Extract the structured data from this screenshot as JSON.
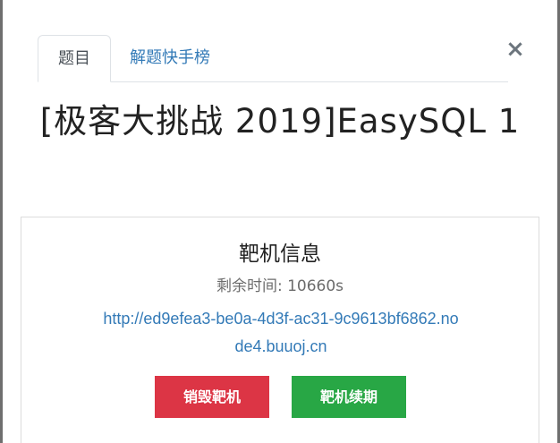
{
  "tabs": {
    "challenge": "题目",
    "leaderboard": "解题快手榜"
  },
  "close_symbol": "×",
  "challenge": {
    "title": "[极客大挑战 2019]EasySQL 1"
  },
  "instance": {
    "heading": "靶机信息",
    "remaining_label": "剩余时间: ",
    "remaining_value": "10660s",
    "url": "http://ed9efea3-be0a-4d3f-ac31-9c9613bf6862.node4.buuoj.cn",
    "destroy_label": "销毁靶机",
    "renew_label": "靶机续期"
  },
  "colors": {
    "link": "#337ab7",
    "danger": "#dc3545",
    "success": "#28a745"
  }
}
